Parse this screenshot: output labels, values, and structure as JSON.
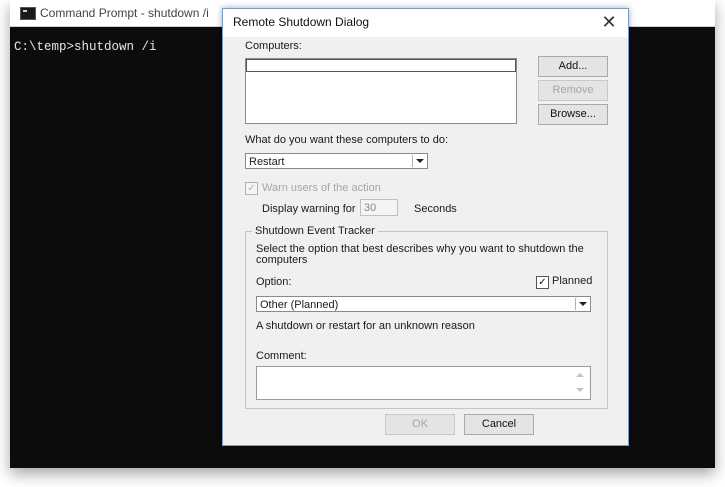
{
  "console": {
    "title": "Command Prompt - shutdown  /i",
    "prompt_text": "C:\\temp>shutdown /i"
  },
  "dialog": {
    "title": "Remote Shutdown Dialog",
    "computers_label": "Computers:",
    "add_button": "Add...",
    "remove_button": "Remove",
    "browse_button": "Browse...",
    "action_label": "What do you want these computers to do:",
    "action_value": "Restart",
    "warn_label": "Warn users of the action",
    "warn_checked": true,
    "display_warning_label": "Display warning for",
    "display_warning_value": "30",
    "seconds_label": "Seconds",
    "tracker": {
      "title": "Shutdown Event Tracker",
      "description": "Select the option that best describes why you want to shutdown the computers",
      "option_label": "Option:",
      "planned_label": "Planned",
      "planned_checked": true,
      "option_value": "Other (Planned)",
      "reason_text": "A shutdown or restart for an unknown reason",
      "comment_label": "Comment:"
    },
    "ok_button": "OK",
    "cancel_button": "Cancel"
  }
}
